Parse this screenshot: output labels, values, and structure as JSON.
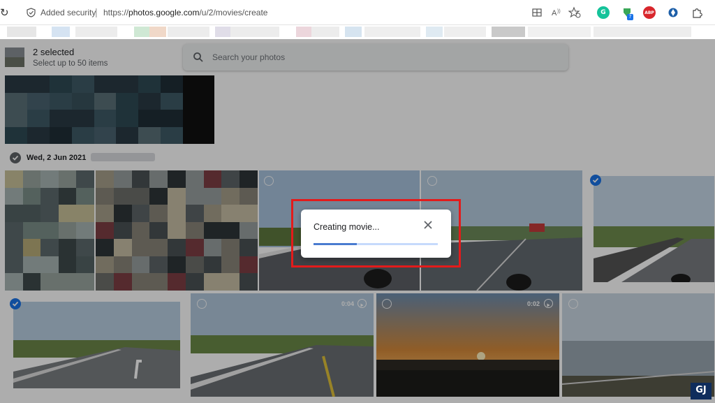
{
  "browser": {
    "security_label": "Added security",
    "separator": "|",
    "url_prefix": "https://",
    "url_host": "photos.google.com",
    "url_path": "/u/2/movies/create",
    "reload_glyph": "↻",
    "toolbar_icons": [
      "split-screen-icon",
      "read-aloud-icon",
      "favorites-icon",
      "grammarly-icon",
      "extension-green-icon",
      "adblock-plus-icon",
      "extension-blue-icon",
      "extensions-puzzle-icon"
    ],
    "extension_badge": "7",
    "adblock_label": "ABP",
    "grammarly_label": "G"
  },
  "header": {
    "title": "2 selected",
    "subtitle": "Select up to 50 items"
  },
  "search": {
    "placeholder": "Search your photos"
  },
  "section": {
    "date": "Wed, 2 Jun 2021"
  },
  "photos": {
    "row2": [
      {
        "selected": false,
        "video": false
      },
      {
        "selected": false,
        "video": false
      },
      {
        "selected": false,
        "video": false
      },
      {
        "selected": false,
        "video": false
      },
      {
        "selected": true,
        "video": false
      }
    ],
    "row3": [
      {
        "selected": true,
        "video": false
      },
      {
        "selected": false,
        "video": true,
        "duration": "0:04"
      },
      {
        "selected": false,
        "video": true,
        "duration": "0:02"
      },
      {
        "selected": false,
        "video": false
      }
    ]
  },
  "dialog": {
    "title": "Creating movie...",
    "progress": 0.35
  },
  "watermark": "GJ",
  "colors": {
    "accent": "#1a73e8",
    "highlight": "#e31b1b",
    "progress_fill": "#4a7cd0"
  }
}
